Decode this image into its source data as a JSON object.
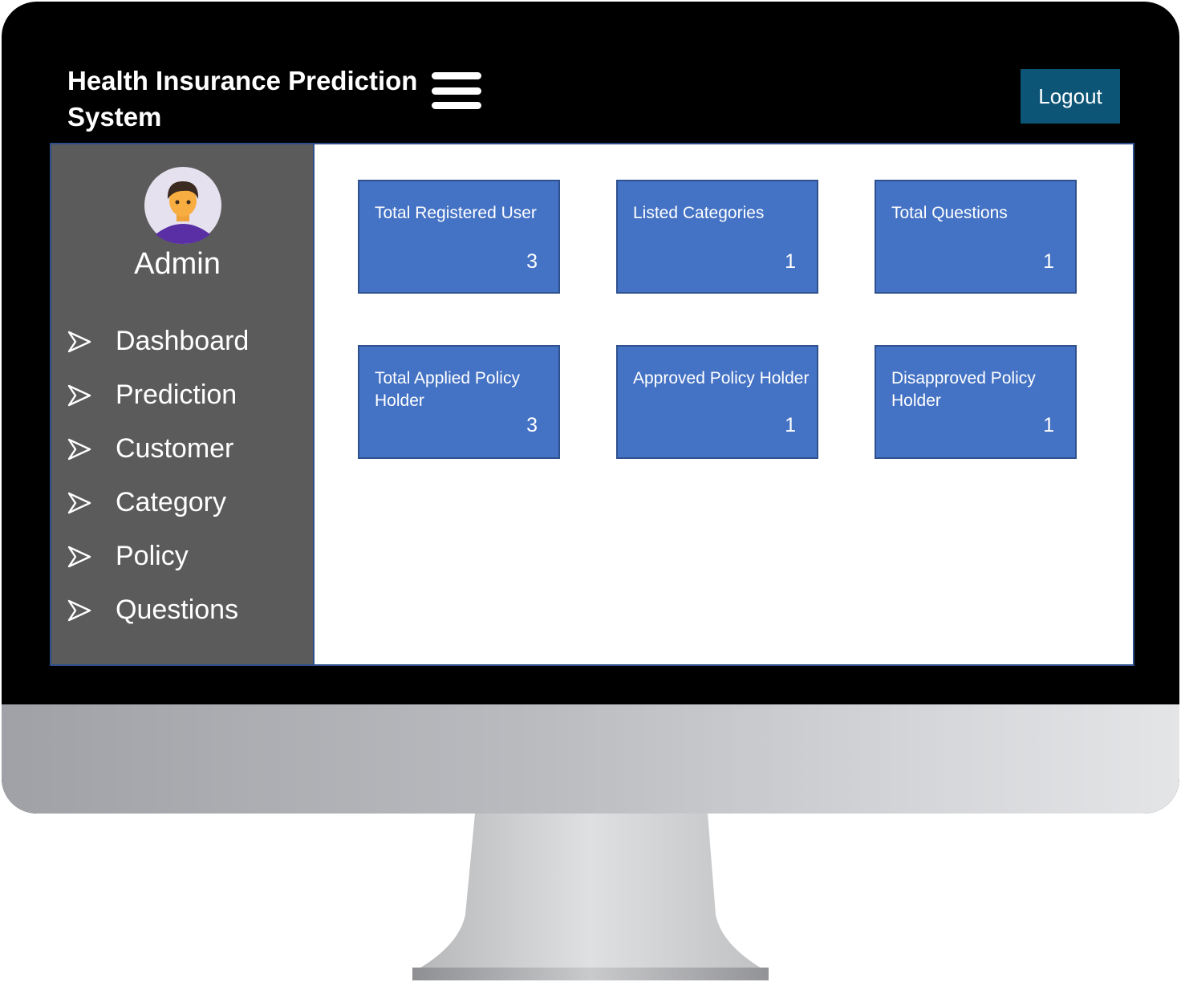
{
  "header": {
    "title": "Health Insurance Prediction System",
    "logout_label": "Logout"
  },
  "sidebar": {
    "user_name": "Admin",
    "items": [
      {
        "label": "Dashboard"
      },
      {
        "label": "Prediction"
      },
      {
        "label": "Customer"
      },
      {
        "label": "Category"
      },
      {
        "label": "Policy"
      },
      {
        "label": "Questions"
      }
    ]
  },
  "cards": [
    {
      "label": "Total Registered User",
      "value": "3"
    },
    {
      "label": "Listed Categories",
      "value": "1"
    },
    {
      "label": "Total Questions",
      "value": "1"
    },
    {
      "label": "Total Applied Policy Holder",
      "value": "3"
    },
    {
      "label": "Approved Policy Holder",
      "value": "1"
    },
    {
      "label": "Disapproved Policy Holder",
      "value": "1"
    }
  ],
  "colors": {
    "header_bg": "#000000",
    "logout_bg": "#0d5577",
    "sidebar_bg": "#5b5b5b",
    "card_bg": "#4472c4",
    "card_border": "#2f528f"
  }
}
